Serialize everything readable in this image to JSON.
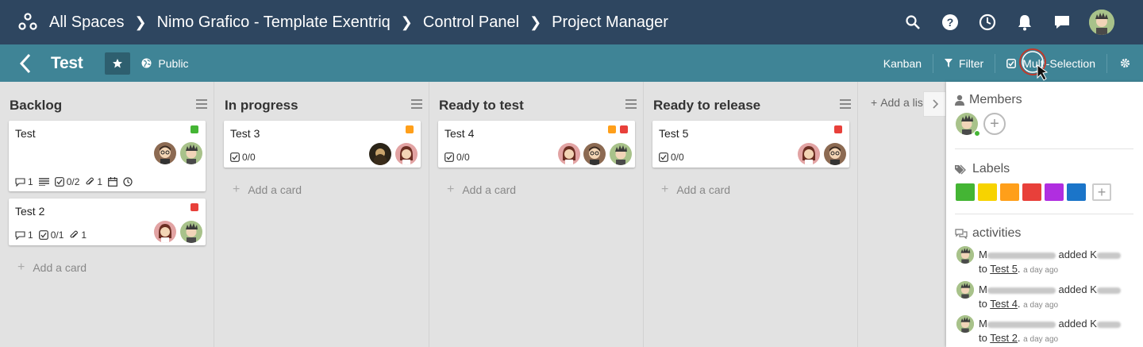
{
  "breadcrumbs": [
    "All Spaces",
    "Nimo Grafico - Template Exentriq",
    "Control Panel",
    "Project Manager"
  ],
  "board": {
    "title": "Test",
    "visibility": "Public"
  },
  "toolbar": {
    "kanban": "Kanban",
    "filter": "Filter",
    "multi_selection": "Multi-Selection"
  },
  "lists": [
    {
      "name": "Backlog",
      "cards": [
        {
          "title": "Test",
          "tags": [
            "#44b534"
          ],
          "comments": "1",
          "checklist": "0/2",
          "attachments": "1"
        },
        {
          "title": "Test 2",
          "tags": [
            "#e8403a"
          ],
          "comments": "1",
          "checklist": "0/1",
          "attachments": "1"
        }
      ],
      "add": "Add a card"
    },
    {
      "name": "In progress",
      "cards": [
        {
          "title": "Test 3",
          "tags": [
            "#ff9f1a"
          ],
          "checklist": "0/0"
        }
      ],
      "add": "Add a card"
    },
    {
      "name": "Ready to test",
      "cards": [
        {
          "title": "Test 4",
          "tags": [
            "#ff9f1a",
            "#e8403a"
          ],
          "checklist": "0/0"
        }
      ],
      "add": "Add a card"
    },
    {
      "name": "Ready to release",
      "cards": [
        {
          "title": "Test 5",
          "tags": [
            "#e8403a"
          ],
          "checklist": "0/0"
        }
      ],
      "add": "Add a card"
    }
  ],
  "add_list": "Add a lis",
  "sidebar": {
    "members_title": "Members",
    "labels_title": "Labels",
    "label_colors": [
      "#44b534",
      "#f7d300",
      "#ff9f1a",
      "#e8403a",
      "#b02ee0",
      "#1b75c9"
    ],
    "activities_title": "activities",
    "activities": [
      {
        "who": "M",
        "verb": "added",
        "obj": "K",
        "to": "to",
        "card": "Test 5",
        "suffix": ".",
        "when": "a day ago"
      },
      {
        "who": "M",
        "verb": "added",
        "obj": "K",
        "to": "to",
        "card": "Test 4",
        "suffix": ".",
        "when": "a day ago"
      },
      {
        "who": "M",
        "verb": "added",
        "obj": "K",
        "to": "to",
        "card": "Test 2",
        "suffix": ".",
        "when": "a day ago"
      }
    ]
  },
  "colors": {
    "topbar": "#2e4660",
    "subbar": "#3f8496",
    "board_bg": "#e2e2e2"
  }
}
